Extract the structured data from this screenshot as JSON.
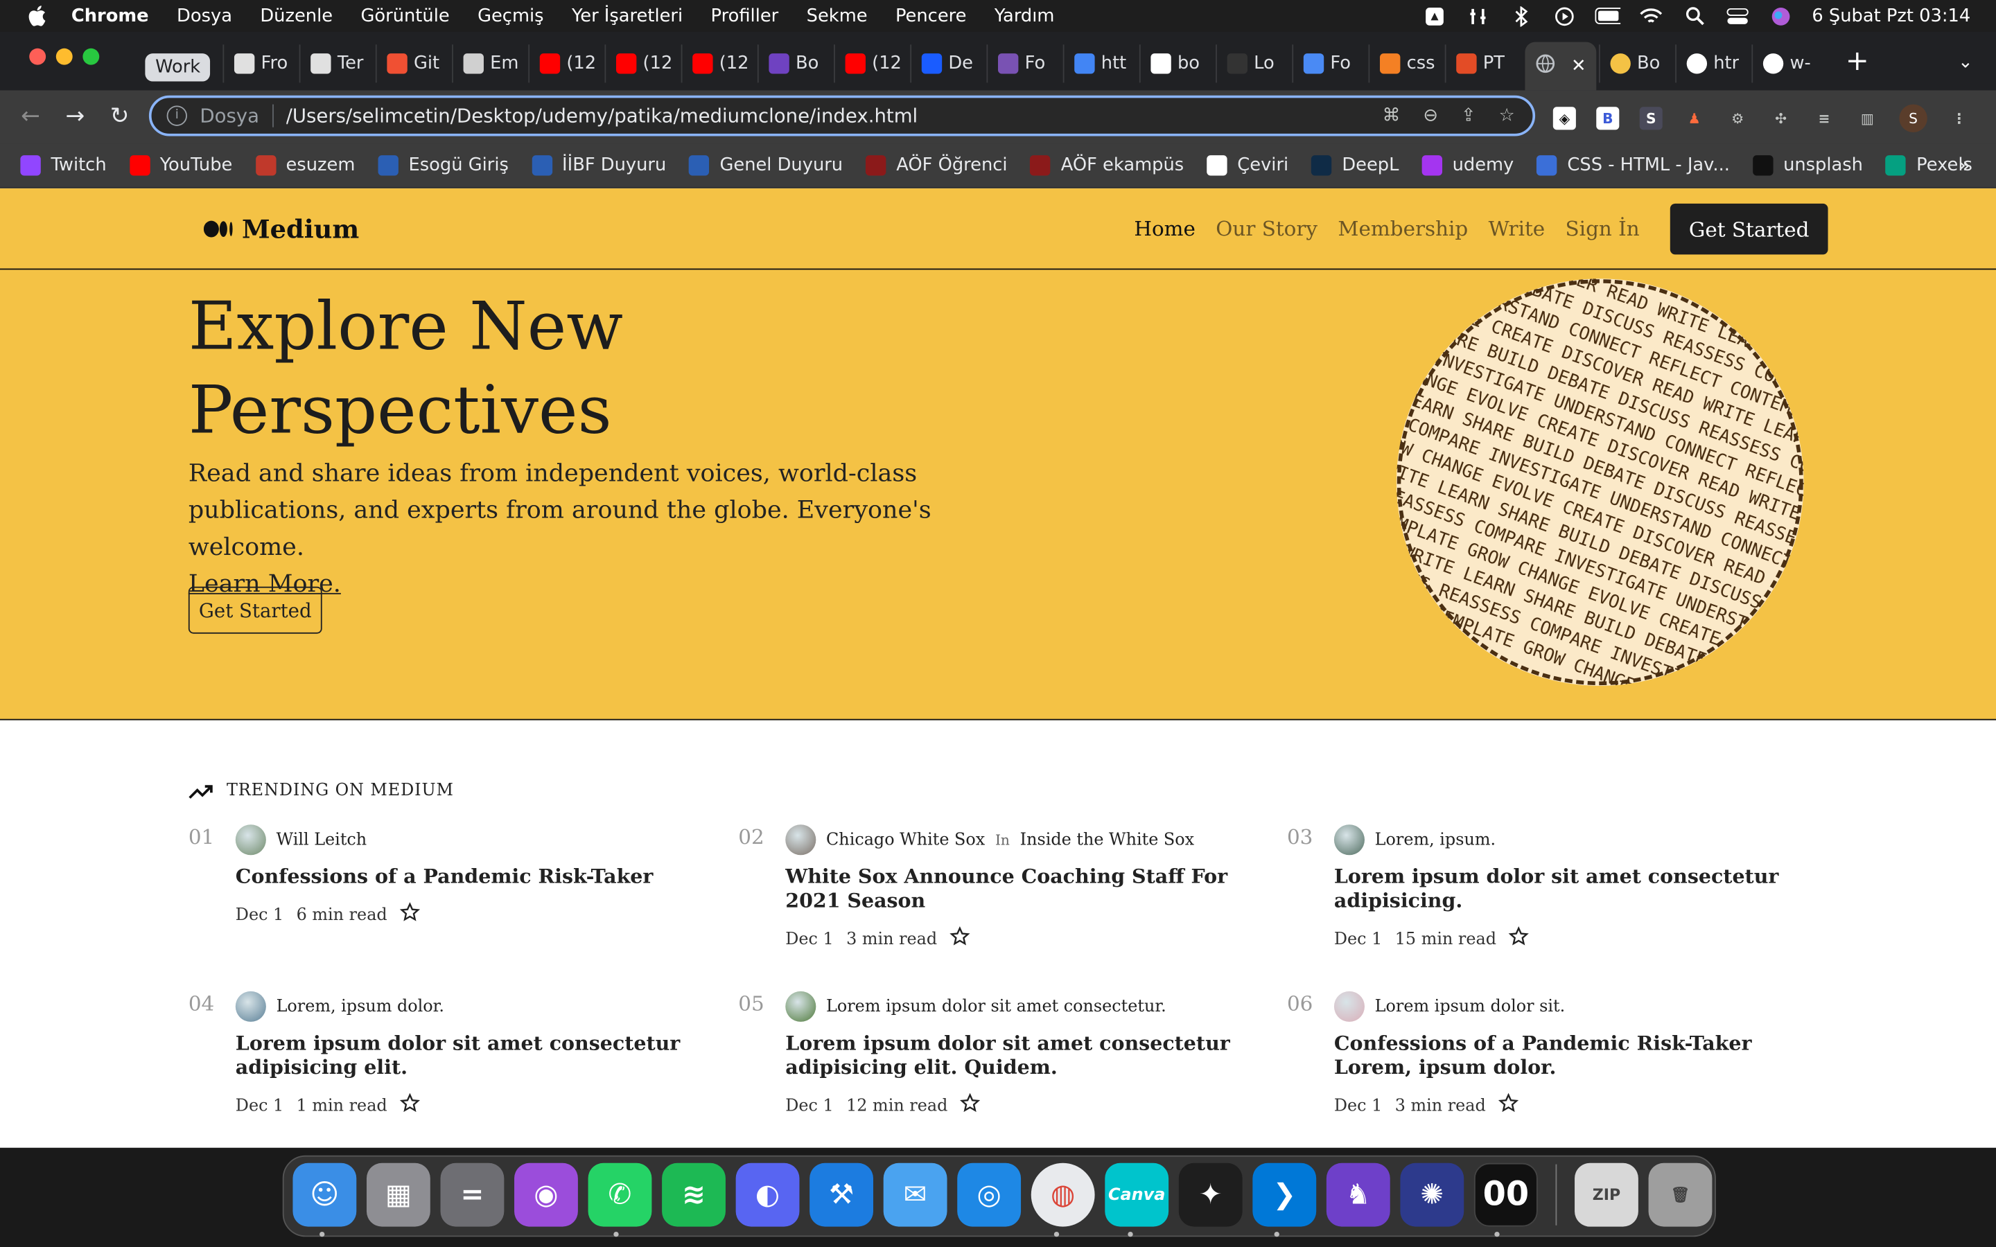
{
  "menubar": {
    "app": "Chrome",
    "items": [
      "Dosya",
      "Düzenle",
      "Görüntüle",
      "Geçmiş",
      "Yer İşaretleri",
      "Profiller",
      "Sekme",
      "Pencere",
      "Yardım"
    ],
    "clock": "6 Şubat Pzt  03:14"
  },
  "tabs": {
    "group_label": "Work",
    "items": [
      {
        "title": "Fro",
        "color": "#e0e0e0"
      },
      {
        "title": "Ter",
        "color": "#e0e0e0"
      },
      {
        "title": "Git",
        "color": "#f05033"
      },
      {
        "title": "Em",
        "color": "#d0d0d0"
      },
      {
        "title": "(12",
        "color": "#ff0000"
      },
      {
        "title": "(12",
        "color": "#ff0000"
      },
      {
        "title": "(12",
        "color": "#ff0000"
      },
      {
        "title": "Bo",
        "color": "#6f42c1"
      },
      {
        "title": "(12",
        "color": "#ff0000"
      },
      {
        "title": "De",
        "color": "#1a5cff"
      },
      {
        "title": "Fo",
        "color": "#7952b3"
      },
      {
        "title": "htt",
        "color": "#4285f4"
      },
      {
        "title": "bo",
        "color": "#ffffff"
      },
      {
        "title": "Lo",
        "color": "#333333"
      },
      {
        "title": "Fo",
        "color": "#4a8af4"
      },
      {
        "title": "css",
        "color": "#f48024"
      },
      {
        "title": "PT",
        "color": "#e34c26"
      }
    ],
    "after": [
      {
        "title": "Bo",
        "color": "#f4c245"
      },
      {
        "title": "htr",
        "color": "#ffffff"
      },
      {
        "title": "w-",
        "color": "#ffffff"
      }
    ]
  },
  "toolbar": {
    "scheme": "Dosya",
    "url": "/Users/selimcetin/Desktop/udemy/patika/mediumclone/index.html",
    "profile_initial": "S"
  },
  "bookmarks": [
    {
      "label": "Twitch",
      "color": "#9146ff"
    },
    {
      "label": "YouTube",
      "color": "#ff0000"
    },
    {
      "label": "esuzem",
      "color": "#c0392b"
    },
    {
      "label": "Esogü Giriş",
      "color": "#2b5fb4"
    },
    {
      "label": "İİBF Duyuru",
      "color": "#2b5fb4"
    },
    {
      "label": "Genel Duyuru",
      "color": "#2b5fb4"
    },
    {
      "label": "AÖF Öğrenci",
      "color": "#8b1a1a"
    },
    {
      "label": "AÖF ekampüs",
      "color": "#8b1a1a"
    },
    {
      "label": "Çeviri",
      "color": "#ffffff"
    },
    {
      "label": "DeepL",
      "color": "#0f2b46"
    },
    {
      "label": "udemy",
      "color": "#a435f0"
    },
    {
      "label": "CSS - HTML - Jav...",
      "color": "#3b6fd8"
    },
    {
      "label": "unsplash",
      "color": "#111111"
    },
    {
      "label": "Pexels",
      "color": "#05a081"
    }
  ],
  "medium": {
    "logo": "Medium",
    "nav": [
      "Home",
      "Our Story",
      "Membership",
      "Write",
      "Sign İn"
    ],
    "nav_cta": "Get Started",
    "hero_title": "Explore New Perspectives",
    "hero_text": "Read and share ideas from independent voices, world-class publications, and experts from around the globe. Everyone's welcome.",
    "hero_link": "Learn More.",
    "hero_button": "Get Started",
    "globe_words": [
      "CREATE",
      "DISCOVER",
      "READ",
      "WRITE",
      "LEARN",
      "SHARE",
      "BUILD",
      "DEBATE",
      "DISCUSS",
      "REASSESS",
      "COMPARE",
      "INVESTIGATE",
      "UNDERSTAND",
      "CONNECT",
      "REFLECT",
      "CONTEMPLATE",
      "GROW",
      "CHANGE",
      "EVOLVE"
    ],
    "trending_heading": "TRENDING ON MEDIUM",
    "posts": [
      {
        "num": "01",
        "author": "Will Leitch",
        "publication": "",
        "title": "Confessions of a Pandemic Risk-Taker",
        "date": "Dec 1",
        "read": "6 min read",
        "avatar": "#6f8a6a"
      },
      {
        "num": "02",
        "author": "Chicago White Sox",
        "publication": "Inside the White Sox",
        "title": "White Sox Announce Coaching Staff For 2021 Season",
        "date": "Dec 1",
        "read": "3 min read",
        "avatar": "#7a6f66"
      },
      {
        "num": "03",
        "author": "Lorem, ipsum.",
        "publication": "",
        "title": "Lorem ipsum dolor sit amet consectetur adipisicing.",
        "date": "Dec 1",
        "read": "15 min read",
        "avatar": "#4e6b5e"
      },
      {
        "num": "04",
        "author": "Lorem, ipsum dolor.",
        "publication": "",
        "title": "Lorem ipsum dolor sit amet consectetur adipisicing elit.",
        "date": "Dec 1",
        "read": "1 min read",
        "avatar": "#5a7f96"
      },
      {
        "num": "05",
        "author": "Lorem ipsum dolor sit amet consectetur.",
        "publication": "",
        "title": "Lorem ipsum dolor sit amet consectetur adipisicing elit. Quidem.",
        "date": "Dec 1",
        "read": "12 min read",
        "avatar": "#4f7a3b"
      },
      {
        "num": "06",
        "author": "Lorem ipsum dolor sit.",
        "publication": "",
        "title": "Confessions of a Pandemic Risk-Taker Lorem, ipsum dolor.",
        "date": "Dec 1",
        "read": "3 min read",
        "avatar": "#d9aeb8"
      }
    ],
    "in_label": "In"
  },
  "dock": [
    {
      "name": "finder",
      "color": "#3a8ee6",
      "glyph": "☺"
    },
    {
      "name": "launchpad",
      "color": "#8e8e93",
      "glyph": "▦"
    },
    {
      "name": "calculator",
      "color": "#6e6e73",
      "glyph": "="
    },
    {
      "name": "podcasts",
      "color": "#9b4ddb",
      "glyph": "◉"
    },
    {
      "name": "whatsapp",
      "color": "#25d366",
      "glyph": "✆"
    },
    {
      "name": "spotify",
      "color": "#1db954",
      "glyph": "≋"
    },
    {
      "name": "discord",
      "color": "#5865f2",
      "glyph": "◐"
    },
    {
      "name": "xcode",
      "color": "#1c7ce0",
      "glyph": "⚒"
    },
    {
      "name": "mail",
      "color": "#4aa3f0",
      "glyph": "✉"
    },
    {
      "name": "safari",
      "color": "#1e88e5",
      "glyph": "◎"
    },
    {
      "name": "chrome",
      "color": "#e8eaed",
      "glyph": "◍"
    },
    {
      "name": "canva",
      "color": "#00c4cc",
      "glyph": "Canva"
    },
    {
      "name": "figma",
      "color": "#1e1e1e",
      "glyph": "✦"
    },
    {
      "name": "vscode",
      "color": "#0078d7",
      "glyph": "❯"
    },
    {
      "name": "github-desktop",
      "color": "#6e40c9",
      "glyph": "♞"
    },
    {
      "name": "astro",
      "color": "#2d3a8c",
      "glyph": "✺"
    },
    {
      "name": "clock-app",
      "color": "#111111",
      "glyph": "00"
    }
  ],
  "dock_right": [
    {
      "name": "archive",
      "color": "#d8d8d8",
      "glyph": "ZIP"
    },
    {
      "name": "trash",
      "color": "#9e9e9e",
      "glyph": "🗑"
    }
  ]
}
